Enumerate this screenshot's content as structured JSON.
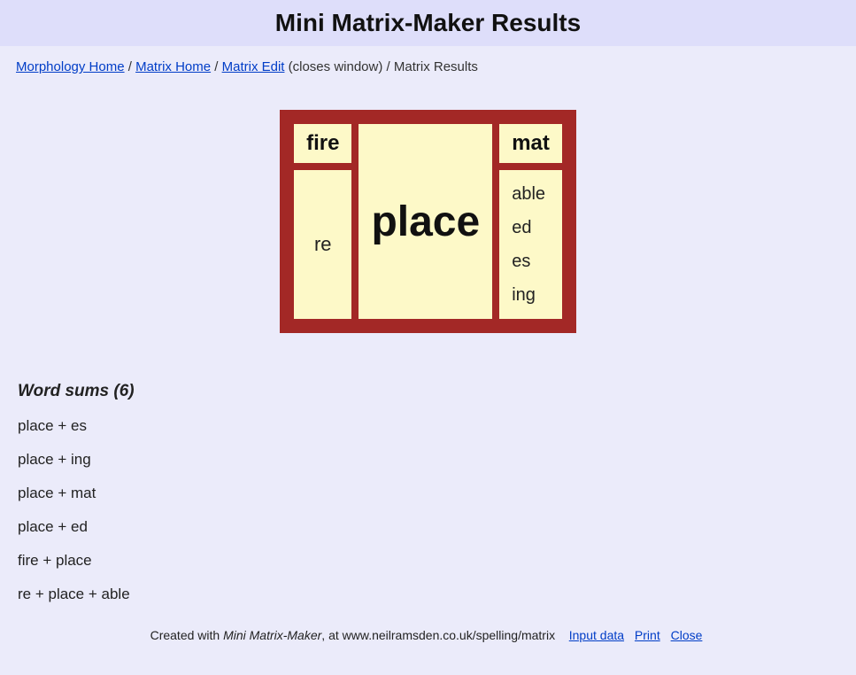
{
  "header": {
    "title": "Mini Matrix-Maker Results"
  },
  "breadcrumb": {
    "items": [
      {
        "label": "Morphology Home",
        "link": true
      },
      {
        "label": "Matrix Home",
        "link": true
      },
      {
        "label": "Matrix Edit",
        "link": true,
        "trail": " (closes window)"
      },
      {
        "label": "Matrix Results",
        "link": false
      }
    ]
  },
  "matrix": {
    "prefixes": [
      "fire",
      "re"
    ],
    "root": "place",
    "suffix_head": "mat",
    "suffix_list": [
      "able",
      "ed",
      "es",
      "ing"
    ]
  },
  "word_sums": {
    "title": "Word sums (6)",
    "items": [
      "place + es",
      "place + ing",
      "place + mat",
      "place + ed",
      "fire + place",
      "re + place + able"
    ]
  },
  "footer": {
    "prefix": "Created with ",
    "tool": "Mini Matrix-Maker",
    "mid": ", at www.neilramsden.co.uk/spelling/matrix",
    "links": [
      "Input data",
      "Print",
      "Close"
    ]
  }
}
